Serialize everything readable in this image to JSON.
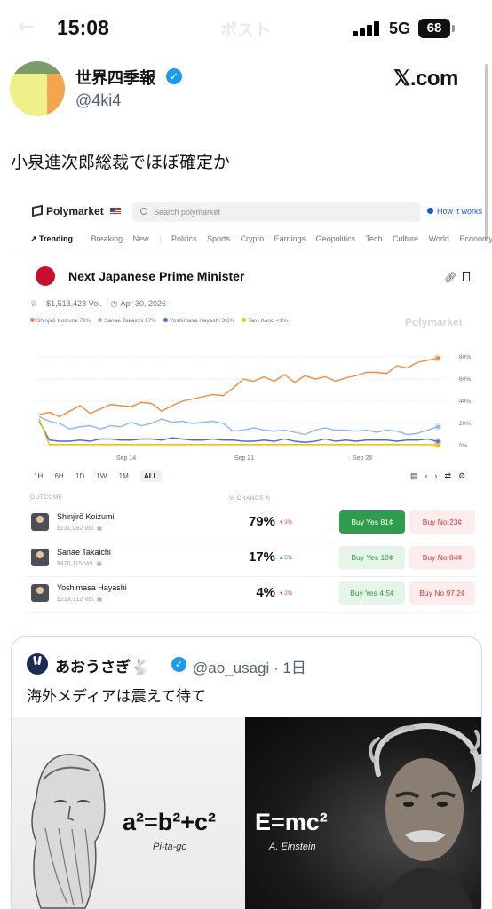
{
  "status_bar": {
    "time": "15:08",
    "network": "5G",
    "battery": "68",
    "ghost_back": "←",
    "ghost_title": "ポスト"
  },
  "post": {
    "author_name": "世界四季報",
    "author_handle": "@4ki4",
    "site": "𝕏.com",
    "text": "小泉進次郎総裁でほぼ確定か",
    "colors": {
      "verified": "#1d9bf0"
    }
  },
  "polymarket": {
    "brand": "Polymarket",
    "search_placeholder": "Search polymarket",
    "how_it_works": "How it works",
    "nav": {
      "trending": "Trending",
      "items_a": [
        "Breaking",
        "New"
      ],
      "items_b": [
        "Politics",
        "Sports",
        "Crypto",
        "Earnings",
        "Geopolitics",
        "Tech",
        "Culture",
        "World",
        "Economy"
      ]
    },
    "market_title": "Next Japanese Prime Minister",
    "volume": "$1,513,423 Vol.",
    "end_date": "Apr 30, 2026",
    "legend": [
      "Shinjirō Koizumi 79%",
      "Sanae Takaichi 17%",
      "Yoshimasa Hayashi 3.6%",
      "Taro Kono <1%"
    ],
    "watermark": "Polymarket",
    "ranges": [
      "1H",
      "6H",
      "1D",
      "1W",
      "1M",
      "ALL"
    ],
    "outcome_header": "OUTCOME",
    "chance_header": "% CHANCE",
    "rows": [
      {
        "name": "Shinjirō Koizumi",
        "vol": "$231,082 Vol.",
        "pct": "79%",
        "chg": "▾ 3%",
        "chg_color": "#e5484d",
        "yes": "Buy Yes 81¢",
        "no": "Buy No 23¢"
      },
      {
        "name": "Sanae Takaichi",
        "vol": "$420,115 Vol.",
        "pct": "17%",
        "chg": "▴ 5%",
        "chg_color": "#2e9b4d",
        "yes": "Buy Yes 18¢",
        "no": "Buy No 84¢"
      },
      {
        "name": "Yoshimasa Hayashi",
        "vol": "$213,312 Vol.",
        "pct": "4%",
        "chg": "▾ 2%",
        "chg_color": "#e5484d",
        "yes": "Buy Yes 4.5¢",
        "no": "Buy No 97.2¢"
      }
    ],
    "colors": {
      "koizumi": "#f0883e",
      "takaichi": "#8fb6ef",
      "hayashi": "#4d6bd6",
      "kono": "#f2c200"
    }
  },
  "chart_data": {
    "type": "line",
    "x_ticks": [
      "Sep 14",
      "Sep 21",
      "Sep 28"
    ],
    "y_ticks": [
      "80%",
      "60%",
      "40%",
      "20%",
      "0%"
    ],
    "ylim": [
      0,
      80
    ],
    "series": [
      {
        "name": "Shinjirō Koizumi",
        "color": "#f0883e",
        "values": [
          28,
          30,
          26,
          31,
          36,
          29,
          33,
          37,
          36,
          35,
          39,
          38,
          31,
          36,
          40,
          42,
          44,
          46,
          45,
          52,
          60,
          58,
          62,
          58,
          64,
          57,
          63,
          60,
          62,
          58,
          61,
          63,
          66,
          66,
          65,
          72,
          70,
          75,
          77,
          79
        ]
      },
      {
        "name": "Sanae Takaichi",
        "color": "#8fb6ef",
        "values": [
          26,
          22,
          20,
          15,
          17,
          18,
          15,
          18,
          17,
          21,
          18,
          20,
          24,
          21,
          22,
          20,
          21,
          22,
          20,
          13,
          14,
          16,
          14,
          13,
          14,
          12,
          10,
          14,
          16,
          14,
          14,
          13,
          14,
          12,
          14,
          13,
          10,
          11,
          14,
          17
        ]
      },
      {
        "name": "Yoshimasa Hayashi",
        "color": "#4d6bd6",
        "values": [
          22,
          5,
          4,
          4,
          5,
          4,
          6,
          6,
          5,
          5,
          6,
          6,
          5,
          7,
          6,
          5,
          5,
          6,
          5,
          5,
          4,
          4,
          5,
          4,
          6,
          4,
          3,
          4,
          6,
          4,
          5,
          4,
          5,
          5,
          5,
          4,
          5,
          5,
          6,
          3.6
        ]
      },
      {
        "name": "Taro Kono",
        "color": "#f2c200",
        "values": [
          24,
          1,
          1,
          1,
          1,
          1,
          1,
          1,
          1,
          1,
          1,
          1,
          1,
          1,
          1,
          1,
          1,
          1,
          1,
          1,
          1,
          1,
          1,
          1,
          1,
          1,
          1,
          1,
          1,
          1,
          1,
          1,
          1,
          1,
          1,
          1,
          1,
          1,
          1,
          0.5
        ]
      }
    ]
  },
  "quote": {
    "author_name": "あおうさぎ🐇",
    "author_handle": "@ao_usagi · 1日",
    "text": "海外メディアは震えて待て",
    "left_formula": "a²=b²+c²",
    "left_caption": "Pi-ta-go",
    "right_formula": "E=mc²",
    "right_caption": "A. Einstein"
  }
}
